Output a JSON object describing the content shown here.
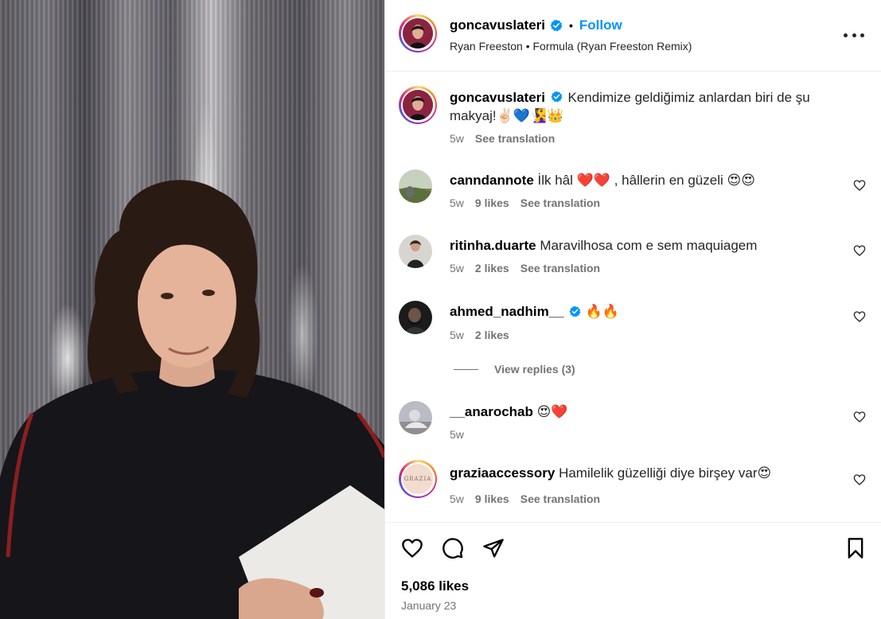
{
  "header": {
    "username": "goncavuslateri",
    "separator": "•",
    "follow_label": "Follow",
    "audio": "Ryan Freeston • Formula (Ryan Freeston Remix)"
  },
  "caption": {
    "username": "goncavuslateri",
    "text": "Kendimize geldiğimiz anlardan biri de şu makyaj!✌🏻💙🧏‍♀️👑",
    "time": "5w",
    "translate": "See translation"
  },
  "comments": [
    {
      "username": "canndannote",
      "text": "İlk hâl ❤️❤️ , hâllerin en güzeli 😍😍",
      "time": "5w",
      "likes": "9 likes",
      "translate": "See translation"
    },
    {
      "username": "ritinha.duarte",
      "text": "Maravilhosa com e sem maquiagem",
      "time": "5w",
      "likes": "2 likes",
      "translate": "See translation"
    },
    {
      "username": "ahmed_nadhim__",
      "text": "🔥🔥",
      "time": "5w",
      "likes": "2 likes"
    },
    {
      "username": "__anarochab",
      "text": "😍❤️",
      "time": "5w"
    },
    {
      "username": "graziaaccessory",
      "text": "Hamilelik güzelliği diye birşey var😍",
      "time": "5w",
      "likes": "9 likes",
      "translate": "See translation",
      "avatar_text": "GRAZIA"
    }
  ],
  "view_replies": "View replies (3)",
  "footer": {
    "likes": "5,086 likes",
    "date": "January 23"
  },
  "icons": [
    "verified-badge-icon",
    "more-options-icon",
    "heart-icon",
    "comment-icon",
    "share-icon",
    "bookmark-icon"
  ],
  "colors": {
    "accent": "#0095f6",
    "text": "#262626",
    "muted": "#737373",
    "border": "#efefef"
  }
}
